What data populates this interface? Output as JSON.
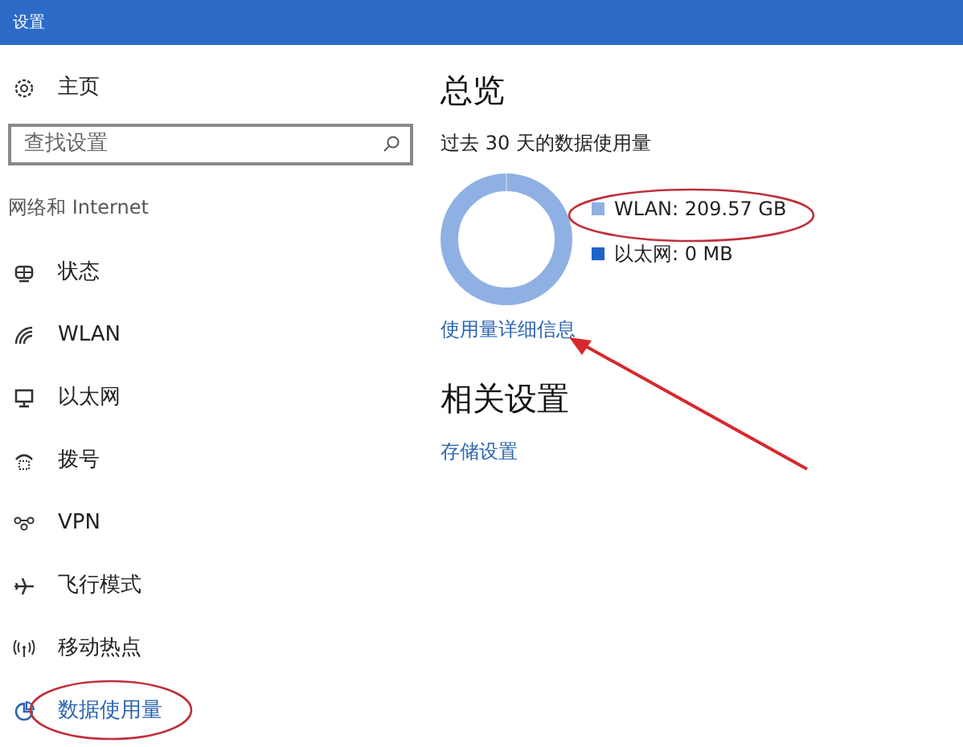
{
  "window": {
    "title": "设置"
  },
  "sidebar": {
    "home": "主页",
    "search": {
      "placeholder": "查找设置"
    },
    "section": "网络和 Internet",
    "items": [
      {
        "label": "状态",
        "selected": false
      },
      {
        "label": "WLAN",
        "selected": false
      },
      {
        "label": "以太网",
        "selected": false
      },
      {
        "label": "拨号",
        "selected": false
      },
      {
        "label": "VPN",
        "selected": false
      },
      {
        "label": "飞行模式",
        "selected": false
      },
      {
        "label": "移动热点",
        "selected": false
      },
      {
        "label": "数据使用量",
        "selected": true
      }
    ]
  },
  "content": {
    "title": "总览",
    "subtitle": "过去 30 天的数据使用量",
    "legend": [
      {
        "label": "WLAN: 209.57 GB",
        "color": "#8fb0e3"
      },
      {
        "label": "以太网: 0 MB",
        "color": "#1e64c8"
      }
    ],
    "details_link": "使用量详细信息",
    "related_title": "相关设置",
    "related_links": [
      "存储设置"
    ]
  }
}
